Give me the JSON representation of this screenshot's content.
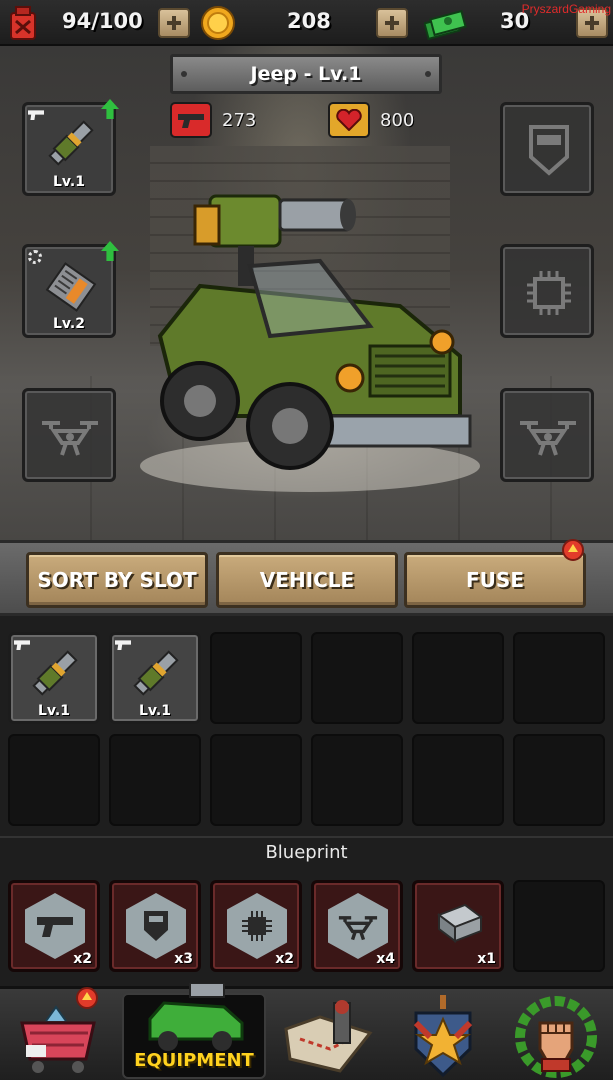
{
  "resources": {
    "fuel": "94/100",
    "coins": "208",
    "cash": "30"
  },
  "watermark": "PryszardGaming",
  "vehicle": {
    "title": "Jeep - Lv.1",
    "attack": "273",
    "health": "800"
  },
  "equipped_slots": {
    "weapon": {
      "level": "Lv.1",
      "icon": "rocket-launcher-icon"
    },
    "chip": {
      "level": "Lv.2",
      "icon": "engine-part-icon"
    },
    "armor": {
      "icon": "armor-shield-icon"
    },
    "core": {
      "icon": "chip-icon"
    },
    "drone_left": {
      "icon": "drone-icon"
    },
    "drone_right": {
      "icon": "drone-icon"
    }
  },
  "tabs": {
    "sort": "SORT BY SLOT",
    "vehicle": "VEHICLE",
    "fuse": "FUSE"
  },
  "inventory": [
    {
      "level": "Lv.1",
      "icon": "rocket-launcher-icon"
    },
    {
      "level": "Lv.1",
      "icon": "rocket-launcher-icon"
    }
  ],
  "blueprint": {
    "label": "Blueprint",
    "items": [
      {
        "icon": "pistol-icon",
        "count": "x2"
      },
      {
        "icon": "armor-shield-icon",
        "count": "x3"
      },
      {
        "icon": "chip-icon",
        "count": "x2"
      },
      {
        "icon": "drone-icon",
        "count": "x4"
      },
      {
        "icon": "metal-plate-icon",
        "count": "x1"
      }
    ]
  },
  "nav": {
    "equipment_label": "EQUIPMENT"
  },
  "colors": {
    "accent_yellow": "#ffd21f",
    "button_tan": "#c9ab7c",
    "upgrade_green": "#2fbf3f",
    "notification_red": "#e23b2a"
  }
}
